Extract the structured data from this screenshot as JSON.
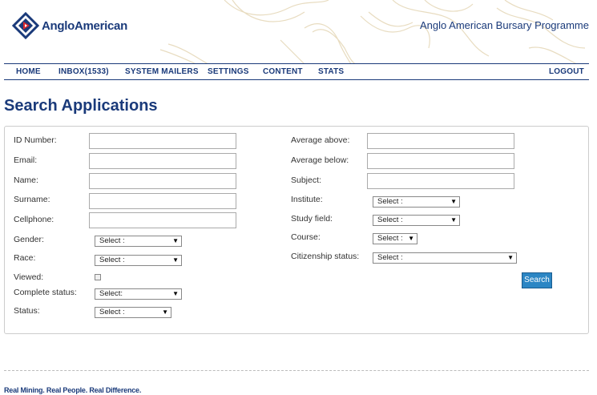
{
  "header": {
    "brand": "AngloAmerican",
    "programme": "Anglo American Bursary Programme"
  },
  "nav": {
    "home": "HOME",
    "inbox": "INBOX(1533)",
    "mailers": "SYSTEM MAILERS",
    "settings": "SETTINGS",
    "content": "CONTENT",
    "stats": "STATS",
    "logout": "LOGOUT"
  },
  "page": {
    "title": "Search Applications"
  },
  "form": {
    "id_number": "ID Number:",
    "email": "Email:",
    "name": "Name:",
    "surname": "Surname:",
    "cellphone": "Cellphone:",
    "gender": "Gender:",
    "race": "Race:",
    "viewed": "Viewed:",
    "complete_status": "Complete status:",
    "status": "Status:",
    "average_above": "Average above:",
    "average_below": "Average below:",
    "subject": "Subject:",
    "institute": "Institute:",
    "study_field": "Study field:",
    "course": "Course:",
    "citizenship": "Citizenship status:",
    "select_default": "Select :",
    "select_complete": "Select:",
    "search_button": "Search"
  },
  "footer": {
    "tagline": "Real Mining. Real People. Real Difference."
  },
  "colors": {
    "brand": "#1a3a7a",
    "button": "#2c86c4"
  }
}
